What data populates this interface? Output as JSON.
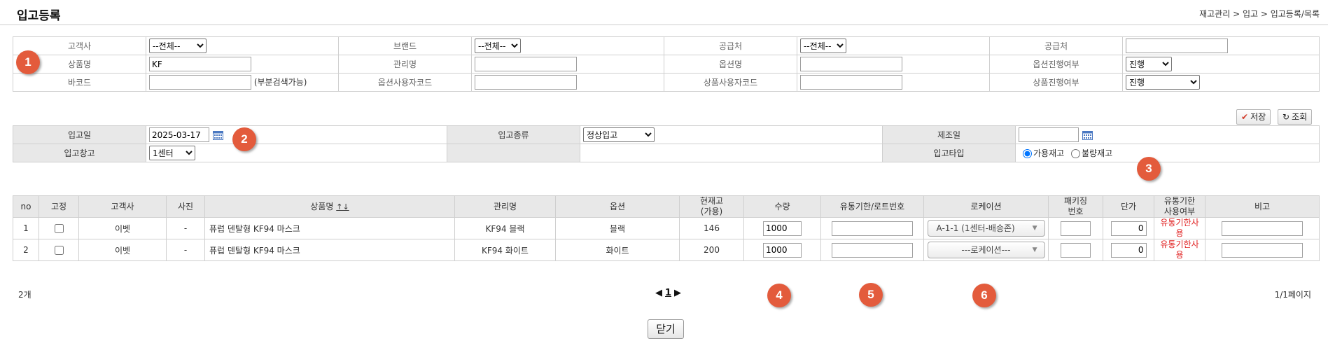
{
  "header": {
    "title": "입고등록",
    "breadcrumb": "재고관리 > 입고 > 입고등록/목록"
  },
  "search": {
    "row1": {
      "customer_label": "고객사",
      "customer_value": "--전체--",
      "brand_label": "브랜드",
      "brand_value": "--전체--",
      "supplier_label": "공급처",
      "supplier_value": "--전체--",
      "supplier2_label": "공급처",
      "supplier2_value": ""
    },
    "row2": {
      "product_label": "상품명",
      "product_value": "KF",
      "mgmt_label": "관리명",
      "mgmt_value": "",
      "option_label": "옵션명",
      "option_value": "",
      "option_status_label": "옵션진행여부",
      "option_status_value": "진행"
    },
    "row3": {
      "barcode_label": "바코드",
      "barcode_value": "",
      "barcode_hint": "(부분검색가능)",
      "option_code_label": "옵션사용자코드",
      "option_code_value": "",
      "product_code_label": "상품사용자코드",
      "product_code_value": "",
      "product_status_label": "상품진행여부",
      "product_status_value": "진행"
    }
  },
  "toolbar": {
    "save_label": "저장",
    "query_label": "조회"
  },
  "entry": {
    "date_label": "입고일",
    "date_value": "2025-03-17",
    "type_label": "입고종류",
    "type_value": "정상입고",
    "mfg_label": "제조일",
    "mfg_value": "",
    "warehouse_label": "입고창고",
    "warehouse_value": "1센터",
    "stock_type_label": "입고타입",
    "stock_opt1": "가용재고",
    "stock_opt2": "불량재고"
  },
  "list": {
    "columns": {
      "no": "no",
      "fixed": "고정",
      "customer": "고객사",
      "photo": "사진",
      "product": "상품명",
      "sort": "↑↓",
      "mgmt": "관리명",
      "option": "옵션",
      "stock1": "현재고",
      "stock2": "(가용)",
      "qty": "수량",
      "expiry": "유통기한/로트번호",
      "location": "로케이션",
      "pack1": "패키징",
      "pack2": "번호",
      "price": "단가",
      "expuse1": "유통기한",
      "expuse2": "사용여부",
      "memo": "비고"
    },
    "rows": [
      {
        "no": "1",
        "customer": "이벳",
        "photo": "-",
        "product": "퓨럽 덴탈형 KF94 마스크",
        "mgmt": "KF94 블랙",
        "option": "블랙",
        "stock": "146",
        "qty": "1000",
        "location": "A-1-1 (1센터-배송존)",
        "price": "0",
        "expuse1": "유통기한사",
        "expuse2": "용"
      },
      {
        "no": "2",
        "customer": "이벳",
        "photo": "-",
        "product": "퓨럽 덴탈형 KF94 마스크",
        "mgmt": "KF94 화이트",
        "option": "화이트",
        "stock": "200",
        "qty": "1000",
        "location": "---로케이션---",
        "price": "0",
        "expuse1": "유통기한사",
        "expuse2": "용"
      }
    ],
    "count": "2개",
    "page": "1",
    "page_info": "1/1페이지"
  },
  "badges": [
    "1",
    "2",
    "3",
    "4",
    "5",
    "6"
  ],
  "close_label": "닫기"
}
